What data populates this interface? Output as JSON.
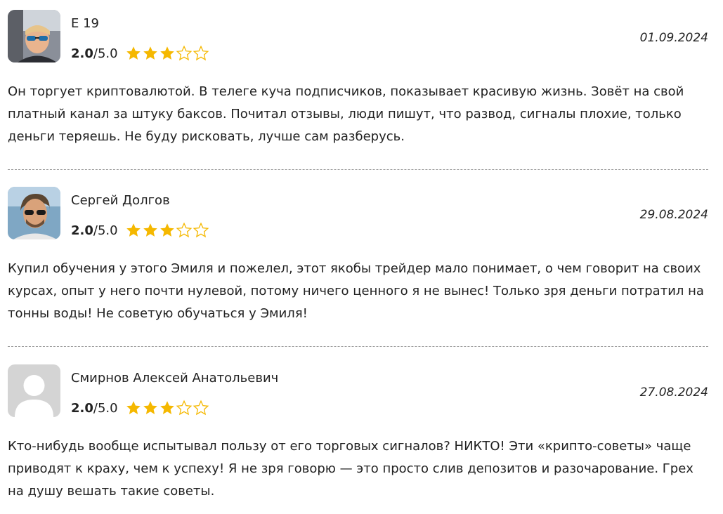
{
  "reviews": [
    {
      "author": "Е 19",
      "score": "2.0",
      "score_max": "/5.0",
      "stars": 3,
      "stars_total": 5,
      "date": "01.09.2024",
      "avatar": "photo-avatar-sunglasses",
      "text": "Он торгует криптовалютой. В телеге куча подписчиков, показывает красивую жизнь. Зовёт на свой платный канал за штуку баксов. Почитал отзывы, люди пишут, что развод, сигналы плохие, только деньги теряешь. Не буду рисковать, лучше сам разберусь."
    },
    {
      "author": "Сергей Долгов",
      "score": "2.0",
      "score_max": "/5.0",
      "stars": 3,
      "stars_total": 5,
      "date": "29.08.2024",
      "avatar": "photo-avatar-man-sunglasses",
      "text": "Купил обучения у этого Эмиля и пожелел, этот якобы трейдер мало понимает, о чем говорит на своих курсах, опыт у него почти нулевой, потому ничего ценного я не вынес! Только зря деньги потратил на тонны воды! Не советую обучаться у Эмиля!"
    },
    {
      "author": "Смирнов Алексей Анатольевич",
      "score": "2.0",
      "score_max": "/5.0",
      "stars": 3,
      "stars_total": 5,
      "date": "27.08.2024",
      "avatar": "default-user-avatar",
      "text": "Кто-нибудь вообще испытывал пользу от его торговых сигналов? НИКТО! Эти «крипто-советы» чаще приводят к краху, чем к успеху! Я не зря говорю — это просто слив депозитов и разочарование. Грех на душу вешать такие советы."
    }
  ],
  "colors": {
    "star_filled": "#F5B800",
    "star_empty_stroke": "#F5B800",
    "divider": "#9a9a9a",
    "text": "#222222"
  },
  "icons": {
    "star_filled": "star-filled-icon",
    "star_empty": "star-empty-icon"
  }
}
